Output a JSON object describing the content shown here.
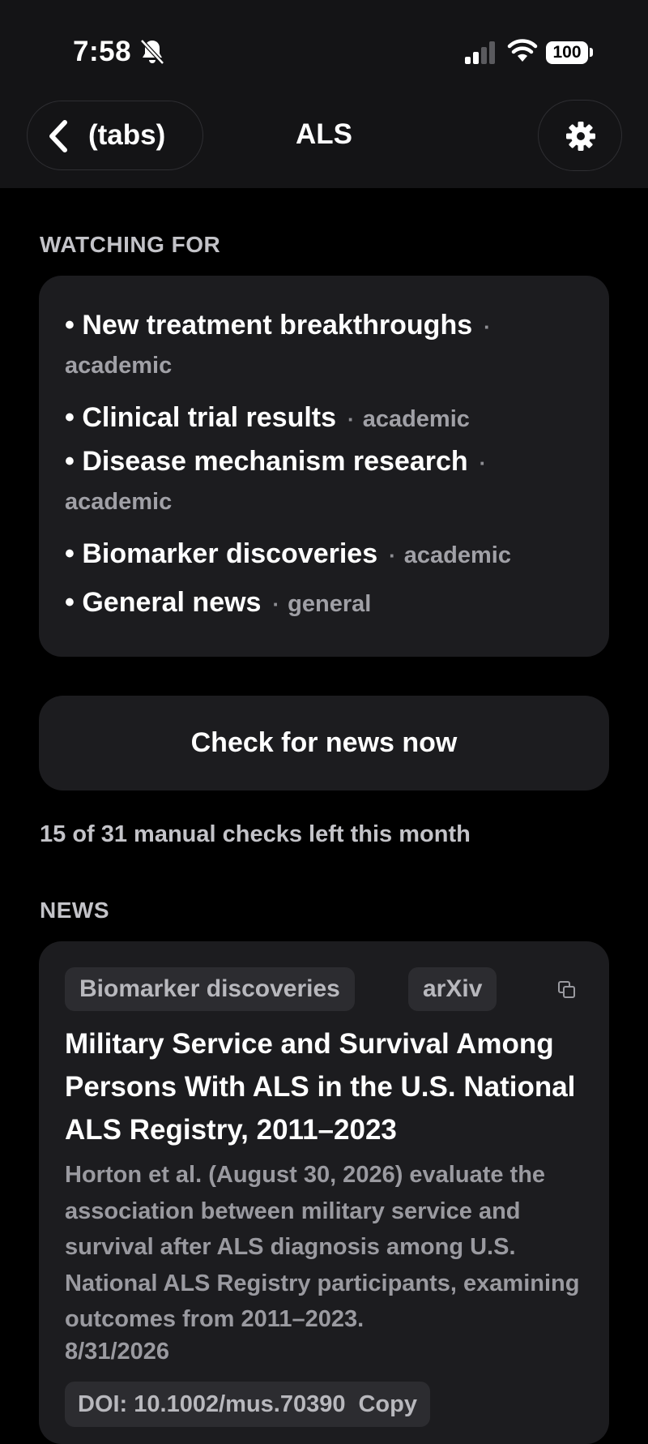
{
  "status": {
    "time": "7:58",
    "battery": "100"
  },
  "nav": {
    "back_label": "(tabs)",
    "title": "ALS"
  },
  "watching": {
    "heading": "WATCHING FOR",
    "items": [
      {
        "label": "New treatment breakthroughs",
        "tag": "academic"
      },
      {
        "label": "Clinical trial results",
        "tag": "academic"
      },
      {
        "label": "Disease mechanism research",
        "tag": "academic"
      },
      {
        "label": "Biomarker discoveries",
        "tag": "academic"
      },
      {
        "label": "General news",
        "tag": "general"
      }
    ]
  },
  "actions": {
    "check_now": "Check for news now",
    "checks_left": "15 of 31 manual checks left this month"
  },
  "news": {
    "heading": "NEWS",
    "items": [
      {
        "topic": "Biomarker discoveries",
        "source": "arXiv",
        "title": "Military Service and Survival Among Persons With ALS in the U.S. National ALS Registry, 2011–2023",
        "summary": "Horton et al. (August 30, 2026) evaluate the association between military service and survival after ALS diagnosis among U.S. National ALS Registry participants, examining outcomes from 2011–2023.",
        "date": "8/31/2026",
        "doi": "DOI: 10.1002/mus.70390",
        "copy_label": "Copy"
      }
    ]
  },
  "colors": {
    "background": "#000000",
    "header": "#141416",
    "card": "#1c1c1f",
    "chip": "#2c2c30",
    "muted_text": "#9a9aa0"
  }
}
